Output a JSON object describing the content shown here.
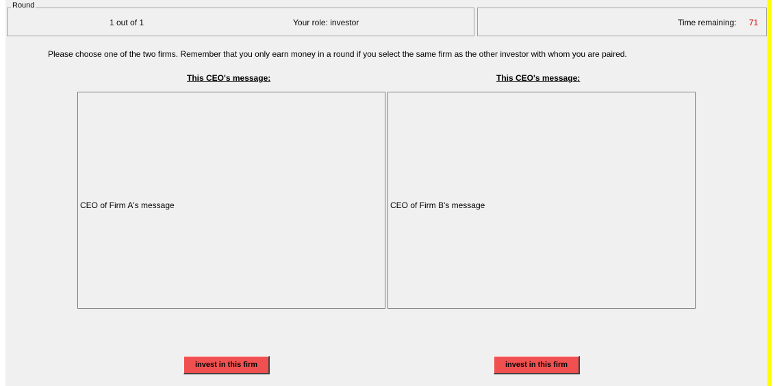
{
  "round_box": {
    "legend": "Round",
    "round_count": "1 out of  1",
    "role": "Your role: investor"
  },
  "timer": {
    "label": "Time remaining:",
    "value": "71",
    "value_color": "#d40000"
  },
  "instructions": "Please choose one of the two firms. Remember that you only earn money in a round if you select the same firm as the other investor with whom you are paired.",
  "firms": [
    {
      "heading": "This CEO's message:",
      "message": "CEO of Firm A's message",
      "button_label": "invest in this firm"
    },
    {
      "heading": "This CEO's message:",
      "message": "CEO of Firm B's message",
      "button_label": "invest in this firm"
    }
  ],
  "colors": {
    "background": "#f0f0f0",
    "button": "#f05050",
    "side_bar": "#ffff00"
  }
}
